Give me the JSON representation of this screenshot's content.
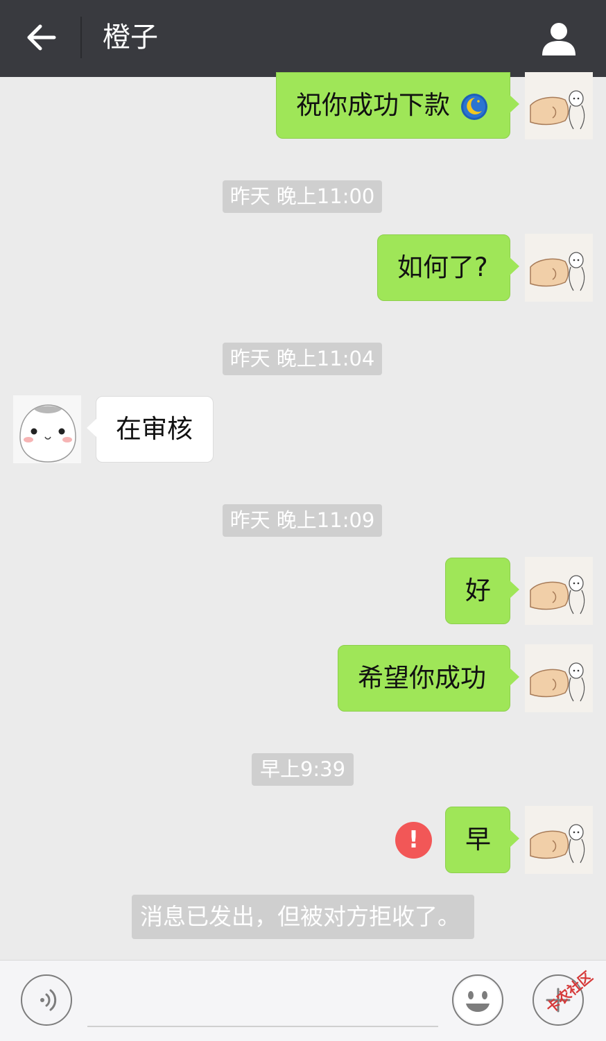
{
  "header": {
    "title": "橙子"
  },
  "messages": [
    {
      "text": "祝你成功下款",
      "emoji": "moon-emoji"
    },
    {
      "text": "如何了?"
    },
    {
      "text": "在审核"
    },
    {
      "text": "好"
    },
    {
      "text": "希望你成功"
    },
    {
      "text": "早",
      "status": "!"
    }
  ],
  "timestamps": [
    "昨天 晚上11:00",
    "昨天 晚上11:04",
    "昨天 晚上11:09",
    "早上9:39"
  ],
  "system_notice": "消息已发出，但被对方拒收了。",
  "watermark": "卡农社区",
  "colors": {
    "header_bg": "#393a3f",
    "bubble_out": "#9fe658",
    "bubble_in": "#ffffff",
    "error": "#f25757"
  }
}
